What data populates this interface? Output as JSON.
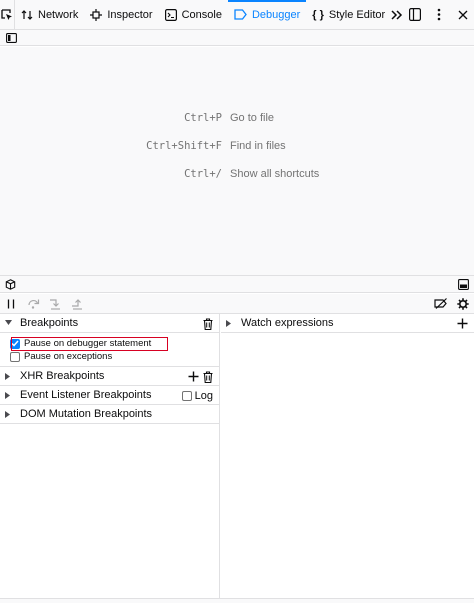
{
  "toolbar": {
    "tabs": [
      {
        "label": "Network",
        "icon": "network-arrows-icon"
      },
      {
        "label": "Inspector",
        "icon": "inspector-icon"
      },
      {
        "label": "Console",
        "icon": "console-icon"
      },
      {
        "label": "Debugger",
        "icon": "debugger-icon",
        "selected": true
      },
      {
        "label": "Style Editor",
        "icon": "style-editor-icon"
      }
    ],
    "more_icon": "double-chevron-right-icon"
  },
  "welcome": {
    "shortcuts": [
      {
        "key": "Ctrl+P",
        "label": "Go to file"
      },
      {
        "key": "Ctrl+Shift+F",
        "label": "Find in files"
      },
      {
        "key": "Ctrl+/",
        "label": "Show all shortcuts"
      }
    ]
  },
  "left_pane": {
    "breakpoints": {
      "title": "Breakpoints",
      "options": [
        {
          "label": "Pause on debugger statement",
          "checked": true
        },
        {
          "label": "Pause on exceptions",
          "checked": false
        }
      ]
    },
    "xhr_breakpoints": {
      "title": "XHR Breakpoints"
    },
    "event_listener_breakpoints": {
      "title": "Event Listener Breakpoints",
      "log_label": "Log"
    },
    "dom_mutation_breakpoints": {
      "title": "DOM Mutation Breakpoints"
    }
  },
  "right_pane": {
    "watch_expressions": {
      "title": "Watch expressions"
    }
  },
  "colors": {
    "accent": "#0a84ff",
    "highlight": "#d70022",
    "text": "#0c0c0d",
    "muted": "#737373",
    "border": "#e0e0e2",
    "toolbar_bg": "#f9f9fa"
  }
}
